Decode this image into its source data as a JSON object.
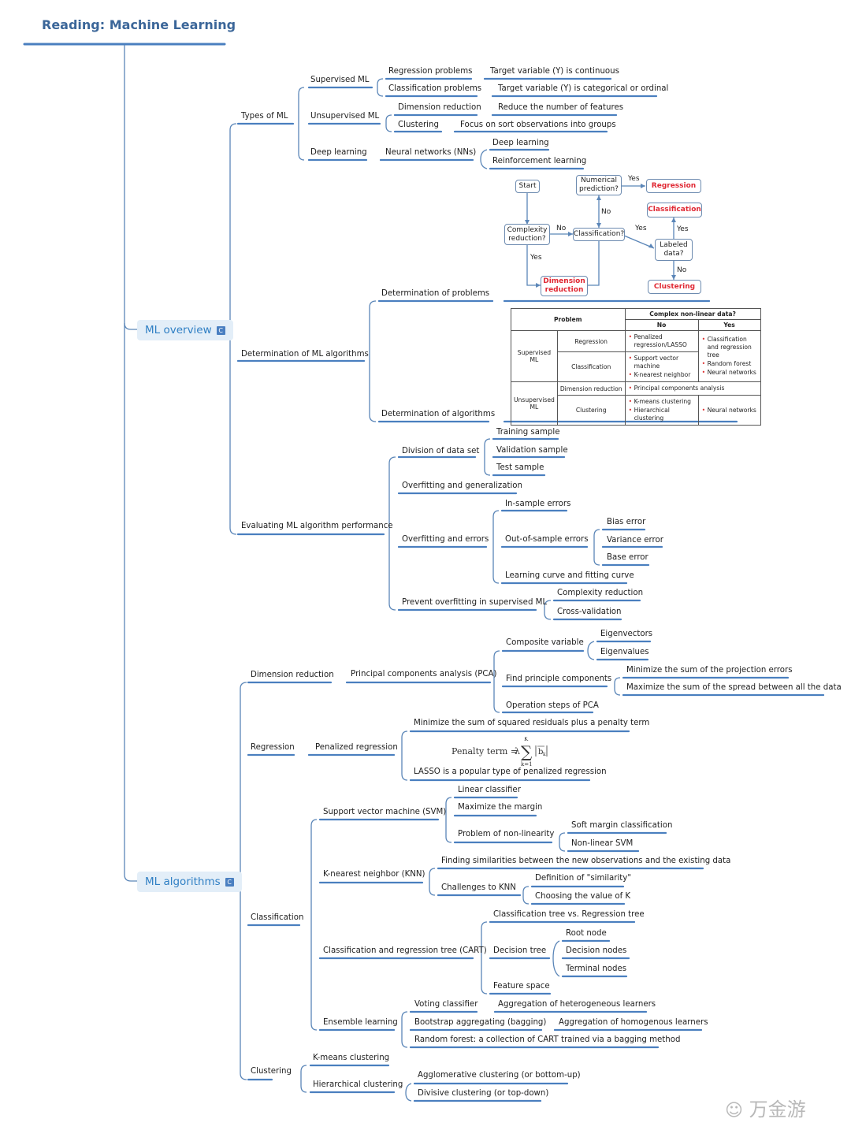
{
  "title": "Reading: Machine Learning",
  "watermark": "万金游",
  "colors": {
    "line": "#4a7fbf",
    "branch_bg": "#e3eef8",
    "branch_text": "#2f7fc4",
    "highlight_red": "#e02833",
    "title": "#3b6699"
  },
  "overview": {
    "label": "ML overview",
    "collapse_icon": "C",
    "types": {
      "label": "Types of ML",
      "supervised": {
        "label": "Supervised ML",
        "regression": "Regression problems",
        "regression_desc": "Target variable (Y) is continuous",
        "classification": "Classification problems",
        "classification_desc": "Target variable (Y) is categorical or ordinal"
      },
      "unsupervised": {
        "label": "Unsupervised ML",
        "dimension": "Dimension reduction",
        "dimension_desc": "Reduce the number of features",
        "clustering": "Clustering",
        "clustering_desc": "Focus on sort observations into groups"
      },
      "deep": {
        "label": "Deep learning",
        "nn": "Neural networks (NNs)",
        "deep": "Deep learning",
        "reinforcement": "Reinforcement learning"
      }
    },
    "determination": {
      "label": "Determination of ML algorithms",
      "problems": "Determination of problems",
      "algorithms": "Determination of algorithms",
      "flowchart": {
        "start": "Start",
        "complexity": "Complexity reduction?",
        "classification_q": "Classification?",
        "numerical": "Numerical prediction?",
        "regression": "Regression",
        "classification": "Classification",
        "labeled": "Labeled data?",
        "clustering": "Clustering",
        "dimension": "Dimension reduction",
        "yes": "Yes",
        "no": "No"
      },
      "table": {
        "problem": "Problem",
        "complex": "Complex non-linear data?",
        "no": "No",
        "yes": "Yes",
        "supervised": "Supervised ML",
        "unsupervised": "Unsupervised ML",
        "regression": "Regression",
        "classification": "Classification",
        "dimension": "Dimension reduction",
        "clustering": "Clustering",
        "reg_no": [
          "Penalized regression/LASSO"
        ],
        "cls_no": [
          "Support vector machine",
          "K-nearest neighbor"
        ],
        "sup_yes": [
          "Classification and regression tree",
          "Random forest",
          "Neural networks"
        ],
        "dim_no": [
          "Principal components analysis"
        ],
        "clu_no": [
          "K-means clustering",
          "Hierarchical clustering"
        ],
        "clu_yes": [
          "Neural networks"
        ]
      }
    },
    "evaluating": {
      "label": "Evaluating ML algorithm performance",
      "division": "Division of data set",
      "training": "Training sample",
      "validation": "Validation sample",
      "test": "Test sample",
      "overfit_gen": "Overfitting and generalization",
      "overfit_err": "Overfitting and errors",
      "in_sample": "In-sample errors",
      "out_sample": "Out-of-sample errors",
      "bias": "Bias error",
      "variance": "Variance error",
      "base": "Base error",
      "learning_curve": "Learning curve and fitting curve",
      "prevent": "Prevent overfitting in supervised ML",
      "complexity": "Complexity reduction",
      "cross": "Cross-validation"
    }
  },
  "algorithms": {
    "label": "ML algorithms",
    "collapse_icon": "C",
    "dimension": {
      "label": "Dimension reduction",
      "pca": "Principal components analysis (PCA)",
      "composite": "Composite variable",
      "eigenvectors": "Eigenvectors",
      "eigenvalues": "Eigenvalues",
      "find": "Find principle components",
      "minimize": "Minimize the sum of the projection errors",
      "maximize": "Maximize the sum of the spread between all the data",
      "steps": "Operation steps of PCA"
    },
    "regression": {
      "label": "Regression",
      "penalized": "Penalized regression",
      "minimize": "Minimize the sum of squared residuals plus a penalty term",
      "formula": "Penalty term = λ Σ(k=1..K) |b̂k|",
      "lasso": "LASSO is a popular type of penalized regression"
    },
    "classification": {
      "label": "Classification",
      "svm": "Support vector machine (SVM)",
      "linear": "Linear classifier",
      "margin": "Maximize the margin",
      "nonlin": "Problem of non-linearity",
      "soft": "Soft margin classification",
      "nonlin_svm": "Non-linear SVM",
      "knn": "K-nearest neighbor (KNN)",
      "finding": "Finding similarities between the new observations and the existing data",
      "challenges": "Challenges to KNN",
      "similarity": "Definition of \"similarity\"",
      "choosing": "Choosing the value of K",
      "cart": "Classification and regression tree (CART)",
      "cls_vs_reg": "Classification tree vs. Regression tree",
      "decision_tree": "Decision tree",
      "root": "Root node",
      "decision_nodes": "Decision nodes",
      "terminal": "Terminal nodes",
      "feature": "Feature space",
      "ensemble": "Ensemble learning",
      "voting": "Voting classifier",
      "heterogeneous": "Aggregation of heterogeneous learners",
      "bagging": "Bootstrap aggregating (bagging)",
      "homogenous": "Aggregation of homogenous learners",
      "rf": "Random forest: a collection of CART trained via a bagging method"
    },
    "clustering": {
      "label": "Clustering",
      "kmeans": "K-means clustering",
      "hier": "Hierarchical clustering",
      "agglo": "Agglomerative clustering (or bottom-up)",
      "divisive": "Divisive clustering (or top-down)"
    }
  }
}
